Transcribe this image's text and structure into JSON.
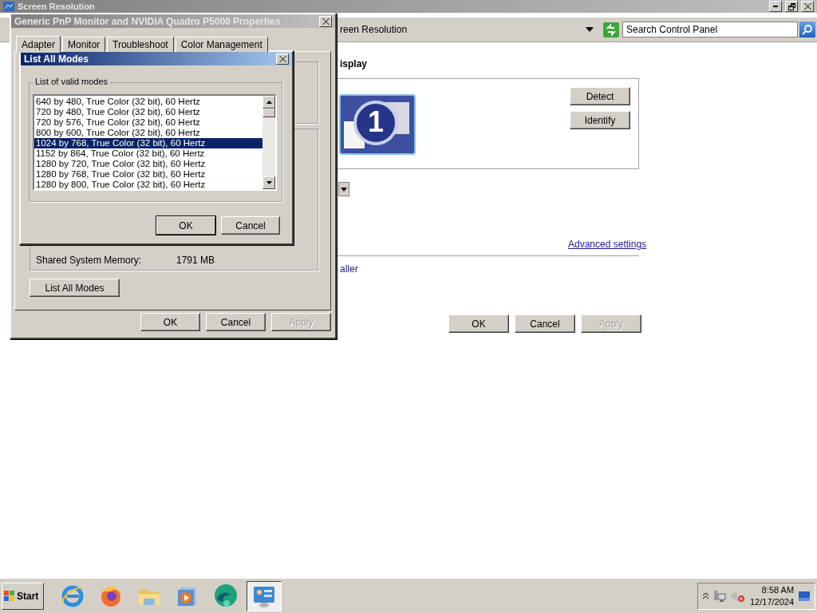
{
  "main_window": {
    "title": "Screen Resolution",
    "address": "reen Resolution",
    "search": {
      "placeholder": "Search Control Panel"
    },
    "heading": "isplay",
    "monitor_number": "1",
    "side_buttons": [
      {
        "label": "Detect"
      },
      {
        "label": "Identify"
      }
    ],
    "advanced_link": "Advanced settings",
    "link_fragment": "aller",
    "footer_buttons": [
      {
        "label": "OK",
        "disabled": false
      },
      {
        "label": "Cancel",
        "disabled": false
      },
      {
        "label": "Apply",
        "disabled": true
      }
    ]
  },
  "properties_dialog": {
    "title": "Generic PnP Monitor and NVIDIA Quadro P5000 Properties",
    "tabs": [
      {
        "label": "Adapter",
        "selected": true
      },
      {
        "label": "Monitor",
        "selected": false
      },
      {
        "label": "Troubleshoot",
        "selected": false
      },
      {
        "label": "Color Management",
        "selected": false
      }
    ],
    "rows": [
      {
        "label": "Shared System Memory:",
        "value": "1791 MB"
      }
    ],
    "list_button": "List All Modes",
    "footer_buttons": [
      {
        "label": "OK",
        "disabled": false
      },
      {
        "label": "Cancel",
        "disabled": false
      },
      {
        "label": "Apply",
        "disabled": true
      }
    ]
  },
  "modes_dialog": {
    "title": "List All Modes",
    "group_label": "List of valid modes",
    "modes": [
      {
        "label": "640 by 480, True Color (32 bit), 60 Hertz",
        "selected": false
      },
      {
        "label": "720 by 480, True Color (32 bit), 60 Hertz",
        "selected": false
      },
      {
        "label": "720 by 576, True Color (32 bit), 60 Hertz",
        "selected": false
      },
      {
        "label": "800 by 600, True Color (32 bit), 60 Hertz",
        "selected": false
      },
      {
        "label": "1024 by 768, True Color (32 bit), 60 Hertz",
        "selected": true
      },
      {
        "label": "1152 by 864, True Color (32 bit), 60 Hertz",
        "selected": false
      },
      {
        "label": "1280 by 720, True Color (32 bit), 60 Hertz",
        "selected": false
      },
      {
        "label": "1280 by 768, True Color (32 bit), 60 Hertz",
        "selected": false
      },
      {
        "label": "1280 by 800, True Color (32 bit), 60 Hertz",
        "selected": false
      }
    ],
    "buttons": [
      {
        "label": "OK",
        "default": true
      },
      {
        "label": "Cancel",
        "default": false
      }
    ]
  },
  "taskbar": {
    "start_label": "Start",
    "apps": [
      {
        "kind": "ie",
        "active": false
      },
      {
        "kind": "firefox",
        "active": false
      },
      {
        "kind": "folder",
        "active": false
      },
      {
        "kind": "media",
        "active": false
      },
      {
        "kind": "edge",
        "active": false
      },
      {
        "kind": "panel",
        "active": true
      }
    ],
    "clock": {
      "time": "8:58 AM",
      "date": "12/17/2024"
    }
  }
}
